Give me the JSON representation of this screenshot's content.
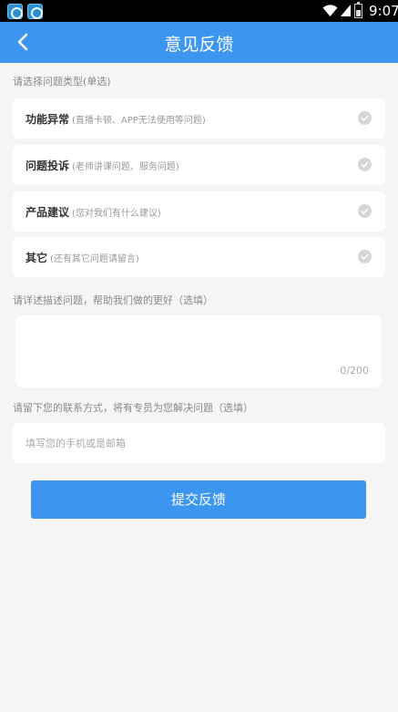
{
  "status_bar": {
    "time": "9:07",
    "app_icon_names": [
      "app-notification-icon",
      "app-notification-icon"
    ]
  },
  "header": {
    "title": "意见反馈",
    "back_icon": "chevron-left-icon"
  },
  "problem_type": {
    "label": "请选择问题类型(单选)",
    "options": [
      {
        "title": "功能异常",
        "desc": "(直播卡顿、APP无法使用等问题)"
      },
      {
        "title": "问题投诉",
        "desc": "(老师讲课问题、服务问题)"
      },
      {
        "title": "产品建议",
        "desc": "(您对我们有什么建议)"
      },
      {
        "title": "其它",
        "desc": "(还有其它问题请留言)"
      }
    ]
  },
  "description": {
    "label": "请详述描述问题，帮助我们做的更好（选填）",
    "counter": "0/200"
  },
  "contact": {
    "label": "请留下您的联系方式，将有专员为您解决问题（选填）",
    "placeholder": "填写您的手机或是邮箱"
  },
  "submit_label": "提交反馈",
  "colors": {
    "primary": "#3c96f0",
    "background": "#f5f5f5",
    "check_inactive": "#d6d6d6"
  }
}
